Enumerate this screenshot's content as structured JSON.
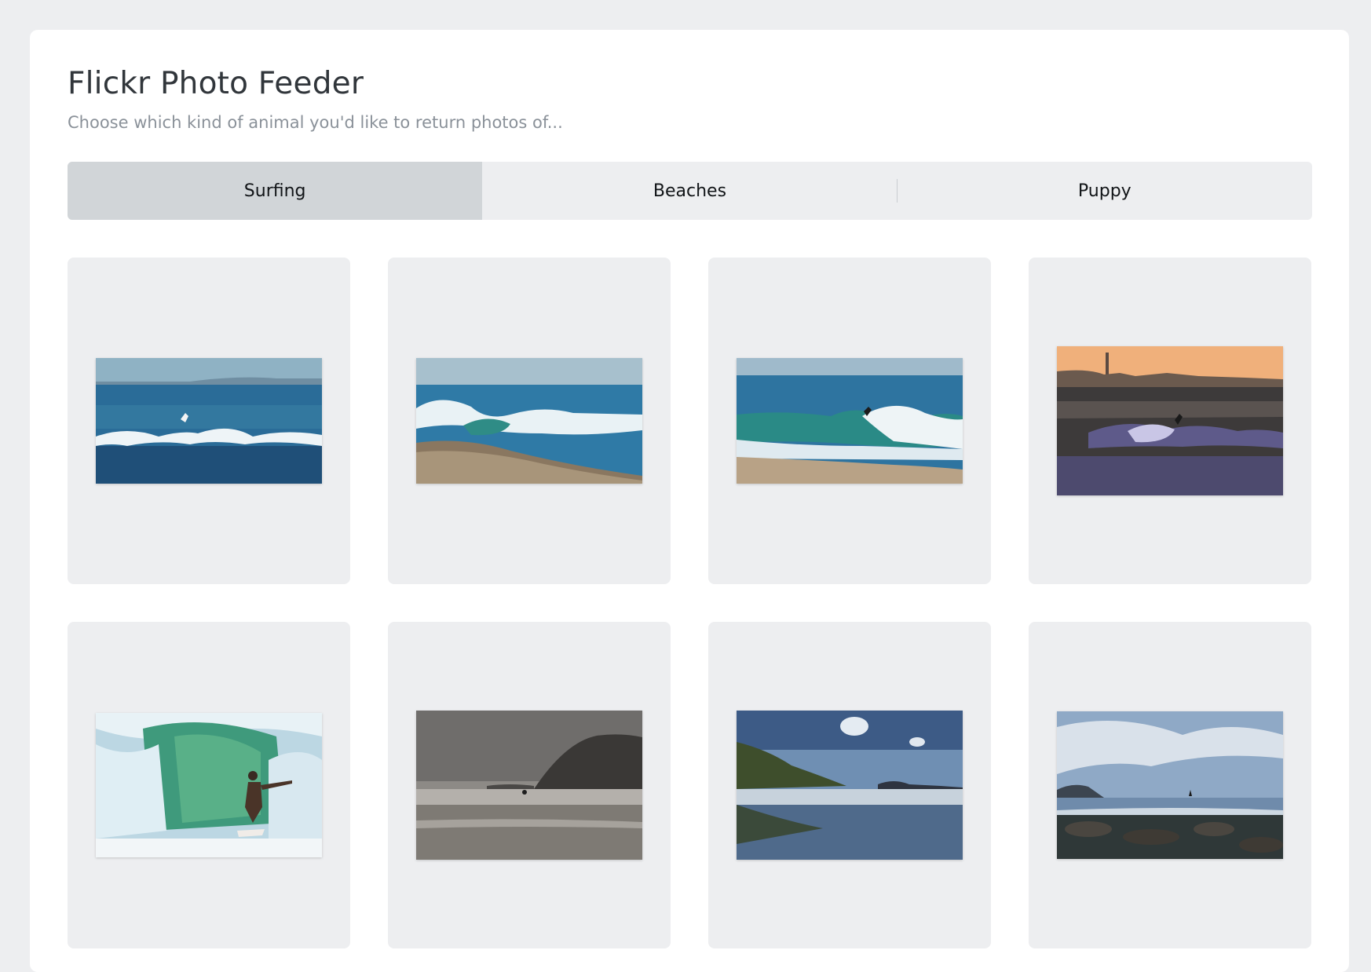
{
  "app": {
    "title": "Flickr Photo Feeder",
    "subtitle": "Choose which kind of animal you'd like to return photos of..."
  },
  "tabs": [
    {
      "label": "Surfing",
      "active": true
    },
    {
      "label": "Beaches",
      "active": false
    },
    {
      "label": "Puppy",
      "active": false
    }
  ],
  "photos": [
    {
      "subject": "surfer-on-wave-blue-ocean"
    },
    {
      "subject": "breaking-wave-sandy-shore"
    },
    {
      "subject": "surfer-cutting-wave-beach"
    },
    {
      "subject": "surfers-at-sunset-city-skyline"
    },
    {
      "subject": "surfer-in-green-barrel"
    },
    {
      "subject": "grey-beach-headland"
    },
    {
      "subject": "beach-reflection-blue-sky"
    },
    {
      "subject": "rocky-shore-surfer-clouds"
    }
  ],
  "colors": {
    "page_background": "#edeef0",
    "card_background": "#ffffff",
    "active_tab": "#d1d5d8",
    "tile_background": "#edeef0"
  }
}
